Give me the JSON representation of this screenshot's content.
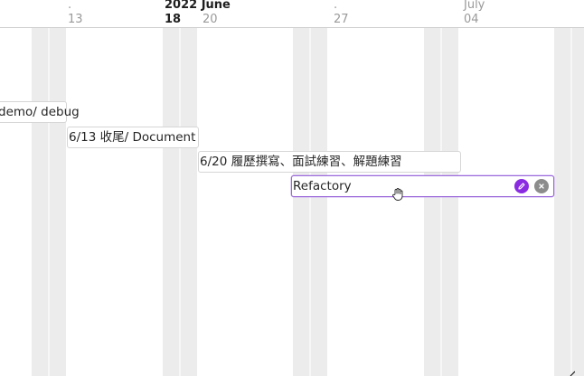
{
  "header": {
    "top_labels": [
      {
        "text": ".",
        "strong": false
      },
      {
        "text": "2022 June",
        "strong": true
      },
      {
        "text": ".",
        "strong": false
      },
      {
        "text": "July",
        "strong": false
      }
    ],
    "days": [
      {
        "text": "13",
        "strong": false
      },
      {
        "text": "18",
        "strong": true
      },
      {
        "text": "20",
        "strong": false
      },
      {
        "text": "27",
        "strong": false
      },
      {
        "text": "04",
        "strong": false
      }
    ]
  },
  "items": [
    {
      "label": "demo/ debug"
    },
    {
      "label": "6/13 收尾/ Document"
    },
    {
      "label": "6/20 履歷撰寫、面試練習、解題練習"
    },
    {
      "label": "Refactory"
    }
  ],
  "colors": {
    "selected_border": "#9b6ad9",
    "edit_button": "#8a2be2",
    "close_button": "#8c8c8c",
    "weekend": "#ececec"
  },
  "icons": {
    "edit": "pencil-icon",
    "close": "close-icon",
    "cursor": "hand-cursor-icon"
  }
}
